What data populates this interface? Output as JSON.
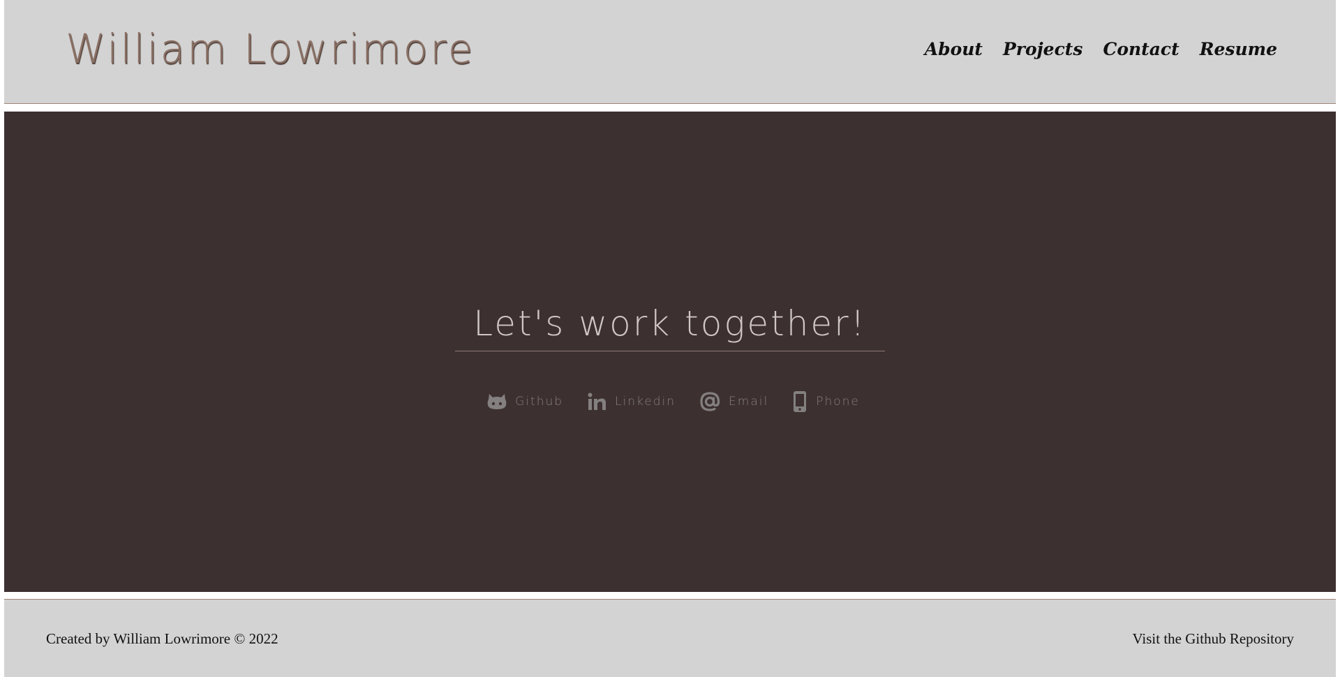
{
  "header": {
    "title": "William Lowrimore",
    "nav": [
      {
        "label": "About"
      },
      {
        "label": "Projects"
      },
      {
        "label": "Contact"
      },
      {
        "label": "Resume"
      }
    ]
  },
  "main": {
    "heading": "Let's work together!",
    "links": [
      {
        "label": "Github",
        "icon": "github-icon"
      },
      {
        "label": "Linkedin",
        "icon": "linkedin-icon"
      },
      {
        "label": "Email",
        "icon": "at-sign-icon"
      },
      {
        "label": "Phone",
        "icon": "mobile-phone-icon"
      }
    ]
  },
  "footer": {
    "credit": "Created by William Lowrimore © 2022",
    "repo_link": "Visit the Github Repository"
  },
  "colors": {
    "header_bg": "#d3d3d3",
    "main_bg": "#3d3031",
    "title_color": "#8a6f63",
    "heading_color": "#cfc7c4",
    "link_color": "#848080"
  }
}
